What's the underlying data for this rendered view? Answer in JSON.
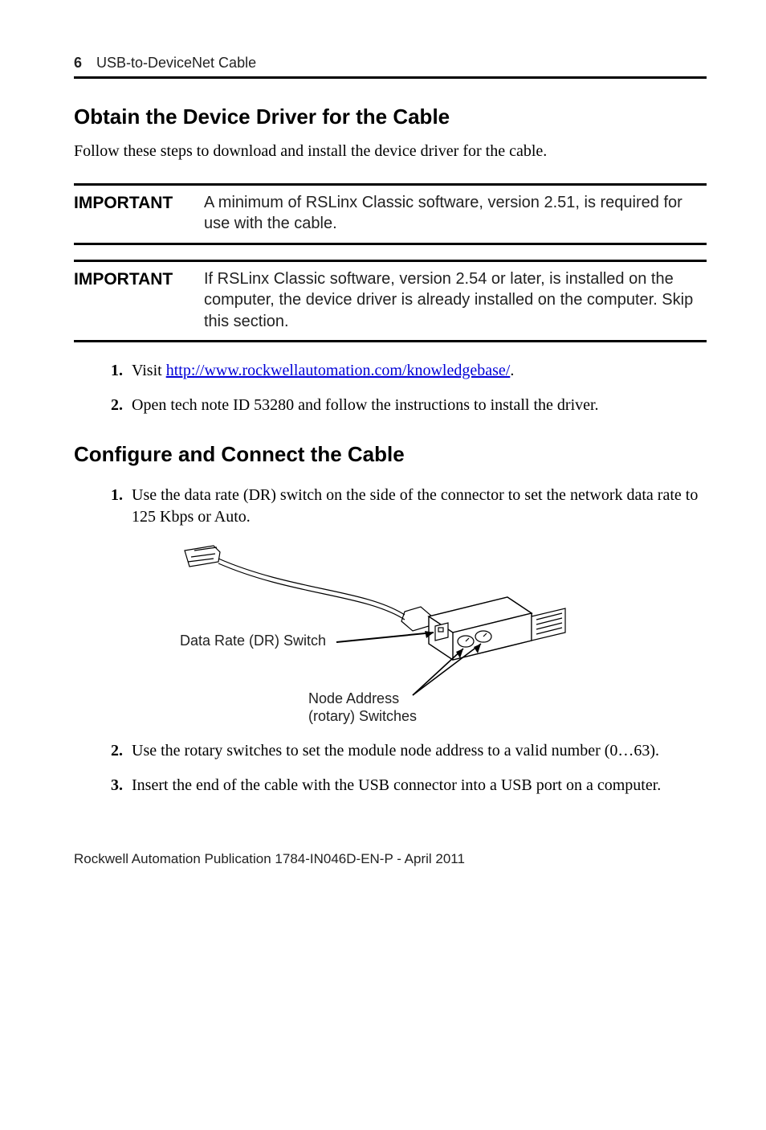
{
  "runningHead": {
    "pageNumber": "6",
    "title": "USB-to-DeviceNet Cable"
  },
  "section1": {
    "heading": "Obtain the Device Driver for the Cable",
    "lead": "Follow these steps to download and install the device driver for the cable.",
    "callouts": [
      {
        "label": "IMPORTANT",
        "body": "A minimum of RSLinx Classic software, version 2.51, is required for use with the cable."
      },
      {
        "label": "IMPORTANT",
        "body": "If RSLinx Classic software, version 2.54 or later, is installed on the computer, the device driver is already installed on the computer. Skip this section."
      }
    ],
    "steps": {
      "s1_prefix": "Visit ",
      "s1_link_text": "http://www.rockwellautomation.com/knowledgebase/",
      "s1_suffix": ".",
      "s2": "Open tech note ID 53280 and follow the instructions to install the driver."
    }
  },
  "section2": {
    "heading": "Configure and Connect the Cable",
    "steps": {
      "s1": "Use the data rate (DR) switch on the side of the connector to set the network data rate to 125 Kbps or Auto.",
      "s2": "Use the rotary switches to set the module node address to a valid number (0…63).",
      "s3": "Insert the end of the cable with the USB connector into a USB port on a computer."
    },
    "diagram": {
      "drLabel": "Data Rate (DR) Switch",
      "nodeLabel1": "Node Address",
      "nodeLabel2": "(rotary) Switches"
    }
  },
  "footer": "Rockwell Automation Publication  1784-IN046D-EN-P - April 2011"
}
